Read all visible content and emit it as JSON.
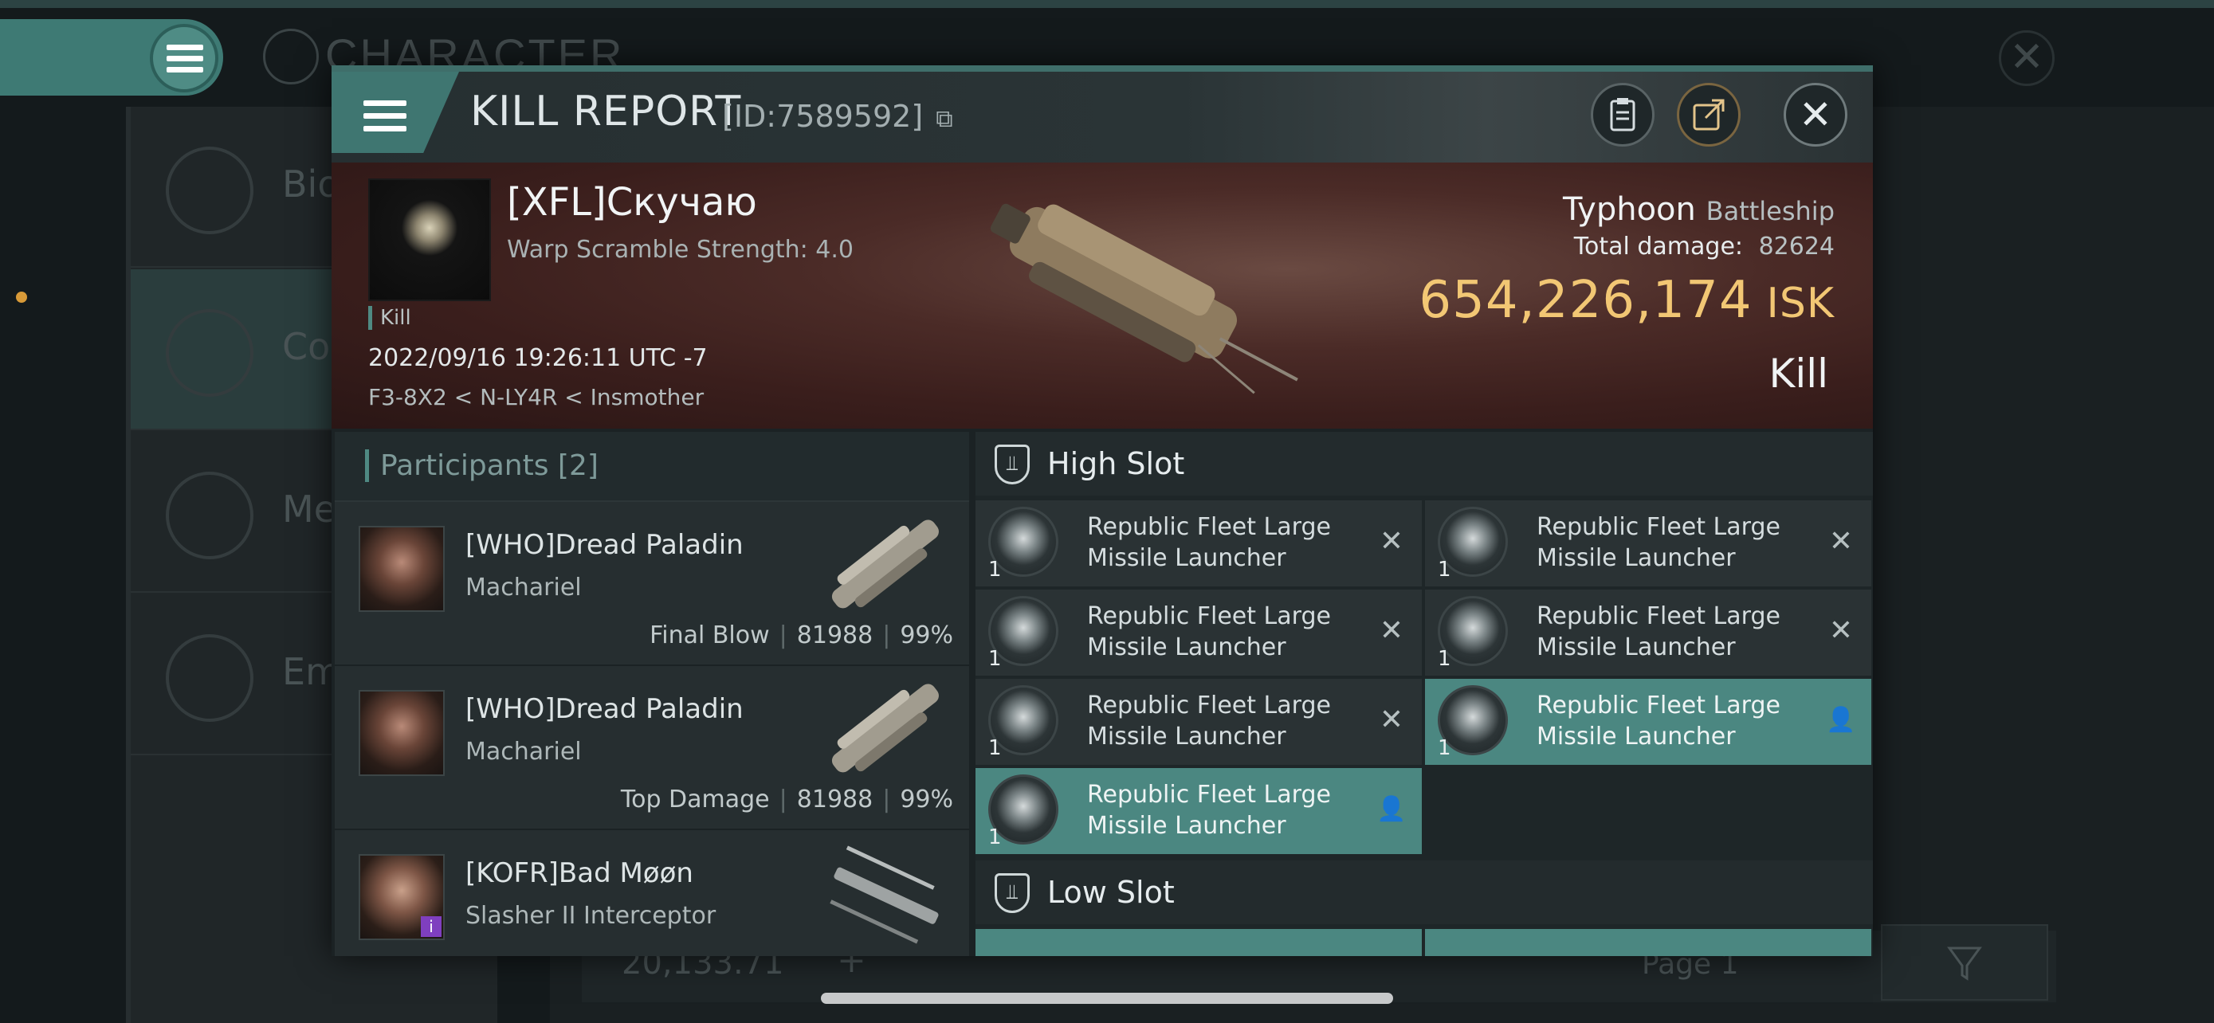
{
  "background": {
    "section_title": "CHARACTER",
    "sidebar_items": [
      "Bio",
      "Co",
      "Me",
      "Em"
    ],
    "footer_value": "20,133.71",
    "footer_add": "+",
    "footer_page": "Page 1"
  },
  "dialog": {
    "title": "KILL REPORT",
    "id_label": "[ID:7589592]",
    "close_glyph": "✕"
  },
  "victim": {
    "name": "[XFL]Скучаю",
    "subtitle": "Warp Scramble Strength: 4.0",
    "kill_tag": "Kill",
    "datetime": "2022/09/16 19:26:11 UTC -7",
    "location": "F3-8X2 < N-LY4R < Insmother",
    "ship_name": "Typhoon",
    "ship_class": "Battleship",
    "total_damage_label": "Total damage:",
    "total_damage": "82624",
    "isk_value": "654,226,174",
    "isk_unit": "ISK",
    "result": "Kill"
  },
  "participants": {
    "title": "Participants [2]",
    "rows": [
      {
        "name": "[WHO]Dread Paladin",
        "ship": "Machariel",
        "role": "Final Blow",
        "damage": "81988",
        "percent": "99%"
      },
      {
        "name": "[WHO]Dread Paladin",
        "ship": "Machariel",
        "role": "Top Damage",
        "damage": "81988",
        "percent": "99%"
      },
      {
        "name": "[KOFR]Bad Møøn",
        "ship": "Slasher II Interceptor",
        "badge": "i"
      }
    ]
  },
  "slots": {
    "high_label": "High Slot",
    "low_label": "Low Slot",
    "modules": [
      {
        "name": "Republic Fleet Large Missile Launcher",
        "qty": "1",
        "status": "destroyed",
        "glyph": "✕"
      },
      {
        "name": "Republic Fleet Large Missile Launcher",
        "qty": "1",
        "status": "destroyed",
        "glyph": "✕"
      },
      {
        "name": "Republic Fleet Large Missile Launcher",
        "qty": "1",
        "status": "destroyed",
        "glyph": "✕"
      },
      {
        "name": "Republic Fleet Large Missile Launcher",
        "qty": "1",
        "status": "destroyed",
        "glyph": "✕"
      },
      {
        "name": "Republic Fleet Large Missile Launcher",
        "qty": "1",
        "status": "destroyed",
        "glyph": "✕"
      },
      {
        "name": "Republic Fleet Large Missile Launcher",
        "qty": "1",
        "status": "dropped",
        "glyph": "👤"
      },
      {
        "name": "Republic Fleet Large Missile Launcher",
        "qty": "1",
        "status": "dropped",
        "glyph": "👤"
      }
    ]
  },
  "colors": {
    "accent": "#4b8781",
    "isk": "#f2c774",
    "banner": "#4b2b27"
  }
}
